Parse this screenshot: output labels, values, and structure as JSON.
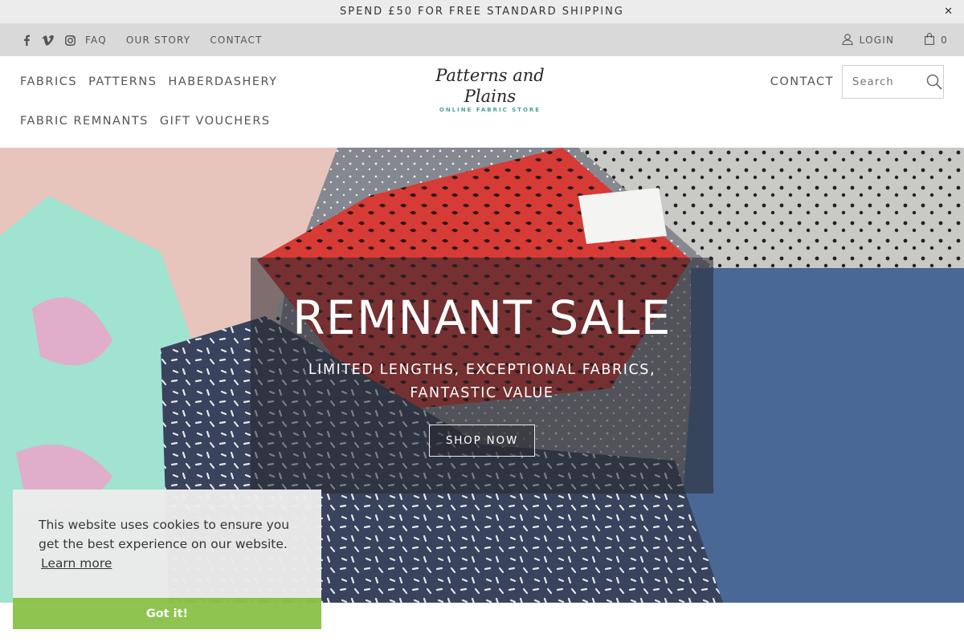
{
  "announcement": {
    "text": "SPEND £50 FOR FREE STANDARD SHIPPING",
    "close": "✕"
  },
  "topbar": {
    "social": [
      "facebook-icon",
      "vimeo-icon",
      "instagram-icon"
    ],
    "links": [
      "FAQ",
      "OUR STORY",
      "CONTACT"
    ],
    "login": "LOGIN",
    "cart_count": "0"
  },
  "nav": {
    "left": [
      "FABRICS",
      "PATTERNS",
      "HABERDASHERY",
      "FABRIC REMNANTS",
      "GIFT VOUCHERS"
    ],
    "contact": "CONTACT"
  },
  "logo": {
    "name": "Patterns and Plains",
    "tagline": "ONLINE FABRIC STORE"
  },
  "search": {
    "placeholder": "Search"
  },
  "hero": {
    "title": "REMNANT SALE",
    "subtitle": "LIMITED LENGTHS, EXCEPTIONAL FABRICS, FANTASTIC VALUE",
    "button": "SHOP NOW"
  },
  "cookie": {
    "message": "This website uses cookies to ensure you get the best experience on our website.",
    "learn_more": "Learn more",
    "accept": "Got it!"
  },
  "colors": {
    "accent": "#8bc34a",
    "logo_teal": "#4aa3a0"
  }
}
